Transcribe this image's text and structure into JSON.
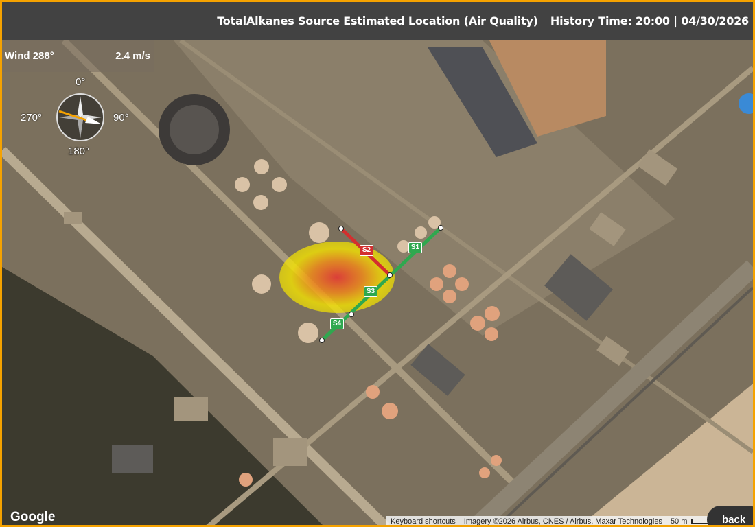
{
  "header": {
    "title": "TotalAlkanes Source Estimated Location (Air Quality)",
    "history_time": "History Time: 20:00 | 04/30/2026"
  },
  "wind": {
    "direction_label": "Wind 288°",
    "speed_label": "2.4 m/s",
    "direction_degrees": 288
  },
  "compass": {
    "north": "0°",
    "east": "90°",
    "south": "180°",
    "west": "270°"
  },
  "segments": [
    {
      "label": "S1",
      "color": "#2fa84f"
    },
    {
      "label": "S2",
      "color": "#d32f2f"
    },
    {
      "label": "S3",
      "color": "#2fa84f"
    },
    {
      "label": "S4",
      "color": "#2fa84f"
    }
  ],
  "footer": {
    "google": "Google",
    "shortcuts": "Keyboard shortcuts",
    "imagery": "Imagery ©2026 Airbus, CNES / Airbus, Maxar Technologies",
    "scale": "50 m",
    "back_label": "back"
  },
  "colors": {
    "accent": "#f5a200",
    "header_bg": "#424242",
    "plume_core": "#e53935",
    "plume_edge": "#f5e400"
  }
}
